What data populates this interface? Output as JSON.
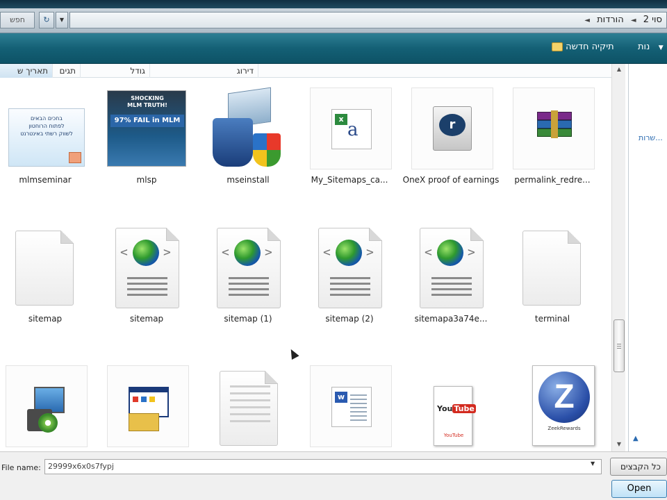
{
  "address_bar": {
    "search_label": "חפש",
    "refresh_glyph": "↻",
    "breadcrumb": [
      "סוי 2",
      "הורדות"
    ]
  },
  "toolbar": {
    "new_folder_label": "תיקיה חדשה",
    "organize_label": "נות"
  },
  "columns": [
    "תאריך ש",
    "תגים",
    "גודל",
    "דירוג"
  ],
  "files": [
    {
      "name": "mlmseminar",
      "icon": "image-thumbnail-icon",
      "thumb_text": "בחכים הבאים\nלפתוח הרוחטון\nלשווק רשתי באינטרנט"
    },
    {
      "name": "mlsp",
      "icon": "image-thumbnail-icon",
      "thumb_text": "SHOCKING MLM TRUTH!\n97% FAIL in MLM"
    },
    {
      "name": "mseinstall",
      "icon": "installer-shield-icon"
    },
    {
      "name": "My_Sitemaps_ca...",
      "icon": "excel-file-icon"
    },
    {
      "name": "OneX proof of earnings",
      "icon": "realplayer-file-icon"
    },
    {
      "name": "permalink_redre...",
      "icon": "winrar-archive-icon"
    },
    {
      "name": "sitemap",
      "icon": "blank-file-icon"
    },
    {
      "name": "sitemap",
      "icon": "xml-globe-file-icon"
    },
    {
      "name": "sitemap (1)",
      "icon": "xml-globe-file-icon"
    },
    {
      "name": "sitemap (2)",
      "icon": "xml-globe-file-icon"
    },
    {
      "name": "sitemapa3a74e...",
      "icon": "xml-globe-file-icon"
    },
    {
      "name": "terminal",
      "icon": "blank-file-icon"
    },
    {
      "name": "",
      "icon": "setup-installer-icon"
    },
    {
      "name": "",
      "icon": "setup-window-icon"
    },
    {
      "name": "",
      "icon": "text-file-icon"
    },
    {
      "name": "",
      "icon": "word-file-icon"
    },
    {
      "name": "",
      "icon": "youtube-thumbnail-icon",
      "thumb_text": "YouTube"
    },
    {
      "name": "",
      "icon": "zeek-rewards-thumbnail-icon",
      "thumb_text": "ZeekRewards"
    }
  ],
  "nav_pane": {
    "link_text": "שרות..."
  },
  "bottom": {
    "filename_label": "File name:",
    "filename_value": "29999x6x0s7fypj",
    "filter_label": "כל הקבצים",
    "open_label": "Open"
  }
}
